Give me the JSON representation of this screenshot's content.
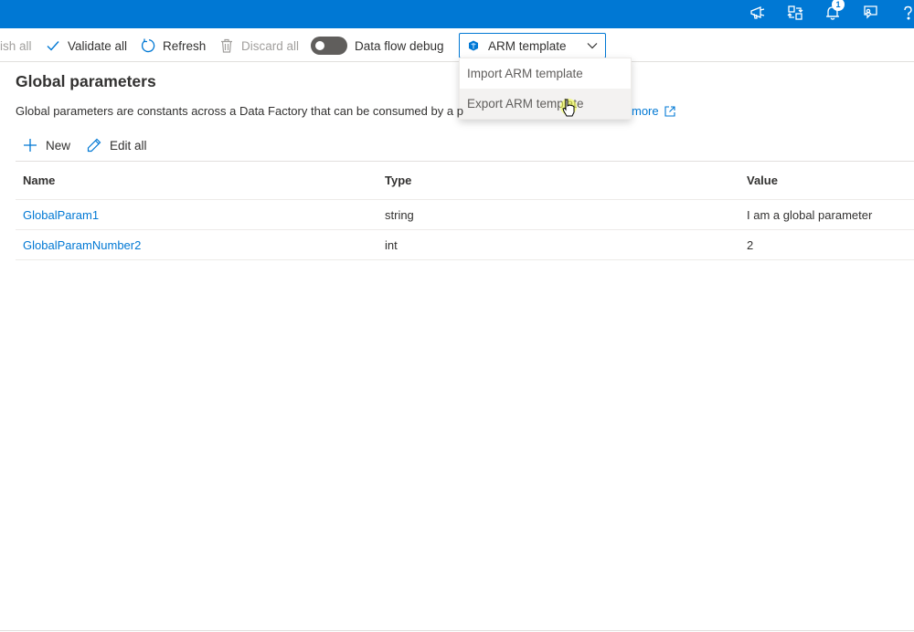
{
  "toolbar": {
    "publish_label": "ish all",
    "validate_label": "Validate all",
    "refresh_label": "Refresh",
    "discard_label": "Discard all",
    "debug_label": "Data flow debug",
    "arm_label": "ARM template"
  },
  "menu": {
    "items": [
      {
        "label": "Import ARM template"
      },
      {
        "label": "Export ARM template"
      }
    ]
  },
  "header": {
    "notification_count": "1"
  },
  "main": {
    "title": "Global parameters",
    "description": "Global parameters are constants across a Data Factory that can be consumed by a p",
    "learn_more": "more",
    "actions": {
      "new_label": "New",
      "edit_label": "Edit all"
    },
    "table": {
      "columns": [
        "Name",
        "Type",
        "Value"
      ],
      "rows": [
        {
          "name": "GlobalParam1",
          "type": "string",
          "value": "I am a global parameter"
        },
        {
          "name": "GlobalParamNumber2",
          "type": "int",
          "value": "2"
        }
      ]
    }
  },
  "colors": {
    "accent": "#0078d4",
    "text": "#323130",
    "disabled": "#a19f9d"
  },
  "icons": [
    "megaphone-icon",
    "directory-switch-icon",
    "bell-icon",
    "feedback-icon",
    "help-icon",
    "checkmark-icon",
    "refresh-icon",
    "trash-icon",
    "arm-icon",
    "chevron-down-icon",
    "plus-icon",
    "pencil-icon",
    "external-link-icon"
  ]
}
